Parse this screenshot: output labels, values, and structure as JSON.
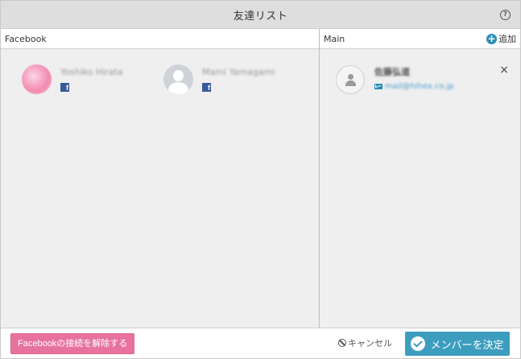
{
  "dialog": {
    "title": "友達リスト",
    "help_icon": "?"
  },
  "facebook": {
    "header": "Facebook",
    "friends": [
      {
        "name": "Yoshiko Hirata",
        "avatar": "photo-avatar",
        "badge": "f"
      },
      {
        "name": "Mami Yamagami",
        "avatar": "default-avatar",
        "badge": "f"
      }
    ]
  },
  "main": {
    "header": "Main",
    "add_label": "追加",
    "add_icon": "+",
    "members": [
      {
        "name": "佐藤弘道",
        "email": "mail@hihex.co.jp",
        "remove_icon": "×"
      }
    ]
  },
  "footer": {
    "disconnect_label": "Facebookの接続を解除する",
    "cancel_label": "キャンセル",
    "decide_label": "メンバーを決定"
  },
  "colors": {
    "accent": "#3c9dbf",
    "facebook_blue": "#3b5998",
    "disconnect_pink": "#e8729e"
  }
}
